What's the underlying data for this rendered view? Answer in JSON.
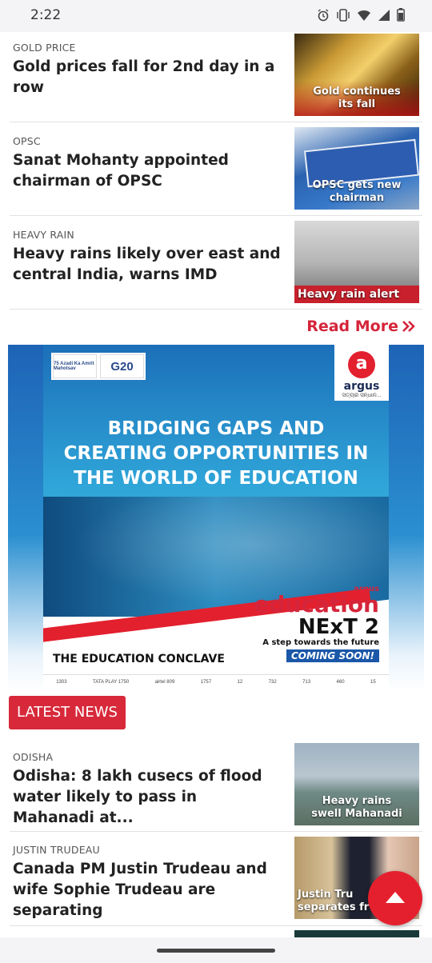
{
  "status_bar": {
    "time": "2:22"
  },
  "top_articles": [
    {
      "category": "GOLD PRICE",
      "headline": "Gold prices fall for 2nd day in a row",
      "thumb_caption": "Gold continues its fall"
    },
    {
      "category": "OPSC",
      "headline": "Sanat Mohanty appointed chairman of OPSC",
      "thumb_caption": "OPSC gets new chairman"
    },
    {
      "category": "HEAVY RAIN",
      "headline": "Heavy rains likely over east and central India, warns IMD",
      "thumb_caption": "Heavy rain alert"
    }
  ],
  "read_more": {
    "label": "Read More"
  },
  "ad": {
    "headline_lines": [
      "BRIDGING GAPS AND",
      "CREATING OPPORTUNITIES IN",
      "THE WORLD OF EDUCATION"
    ],
    "logo_text": "argus",
    "logo_sub": "ସତ୍ୟର ସନ୍ଧାନ...",
    "logo_letter": "a",
    "badge_left": "75 Azadi Ka Amrit Mahotsav",
    "badge_right": "G20",
    "brand_small": "argus",
    "brand_line1": "education",
    "brand_line2": "NExT 2",
    "brand_tagline": "A step towards the future",
    "brand_cta": "COMING SOON!",
    "bottom_text": "THE EDUCATION CONCLAVE",
    "channels": [
      "1303",
      "TATA PLAY 1750",
      "airtel 809",
      "1757",
      "12",
      "732",
      "713",
      "460",
      "15"
    ]
  },
  "latest_news": {
    "label": "LATEST NEWS"
  },
  "latest_articles": [
    {
      "category": "ODISHA",
      "headline": "Odisha: 8 lakh cusecs of flood water likely to pass in Mahanadi at...",
      "thumb_caption": "Heavy rains swell Mahanadi"
    },
    {
      "category": "JUSTIN TRUDEAU",
      "headline": "Canada PM Justin Trudeau and wife Sophie Trudeau are separating",
      "thumb_caption": "Justin Tru separates fr"
    }
  ],
  "colors": {
    "accent": "#d5253a",
    "fab": "#e5202e"
  },
  "icons": [
    "alarm-icon",
    "vibrate-icon",
    "wifi-icon",
    "signal-icon",
    "battery-icon",
    "double-chevron-right-icon",
    "arrow-up-icon"
  ]
}
